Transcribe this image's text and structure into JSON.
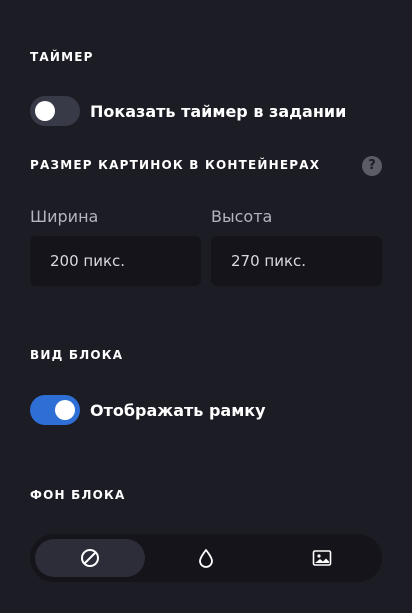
{
  "timer": {
    "heading": "ТАЙМЕР",
    "toggle_label": "Показать таймер в задании",
    "enabled": false
  },
  "image_size": {
    "heading": "РАЗМЕР КАРТИНОК В КОНТЕЙНЕРАХ",
    "help_icon": "question-circle-icon",
    "help_glyph": "?",
    "width_label": "Ширина",
    "width_value": "200 пикс.",
    "height_label": "Высота",
    "height_value": "270 пикс."
  },
  "block_view": {
    "heading": "ВИД БЛОКА",
    "toggle_label": "Отображать рамку",
    "enabled": true
  },
  "block_background": {
    "heading": "ФОН БЛОКА",
    "options": [
      {
        "icon": "no-background-icon",
        "selected": true
      },
      {
        "icon": "color-drop-icon",
        "selected": false
      },
      {
        "icon": "image-icon",
        "selected": false
      }
    ]
  },
  "colors": {
    "background": "#1c1c24",
    "field": "#14141a",
    "toggle_on": "#2e6fd6",
    "toggle_off": "#393a47",
    "segment_active": "#2c2d38"
  }
}
